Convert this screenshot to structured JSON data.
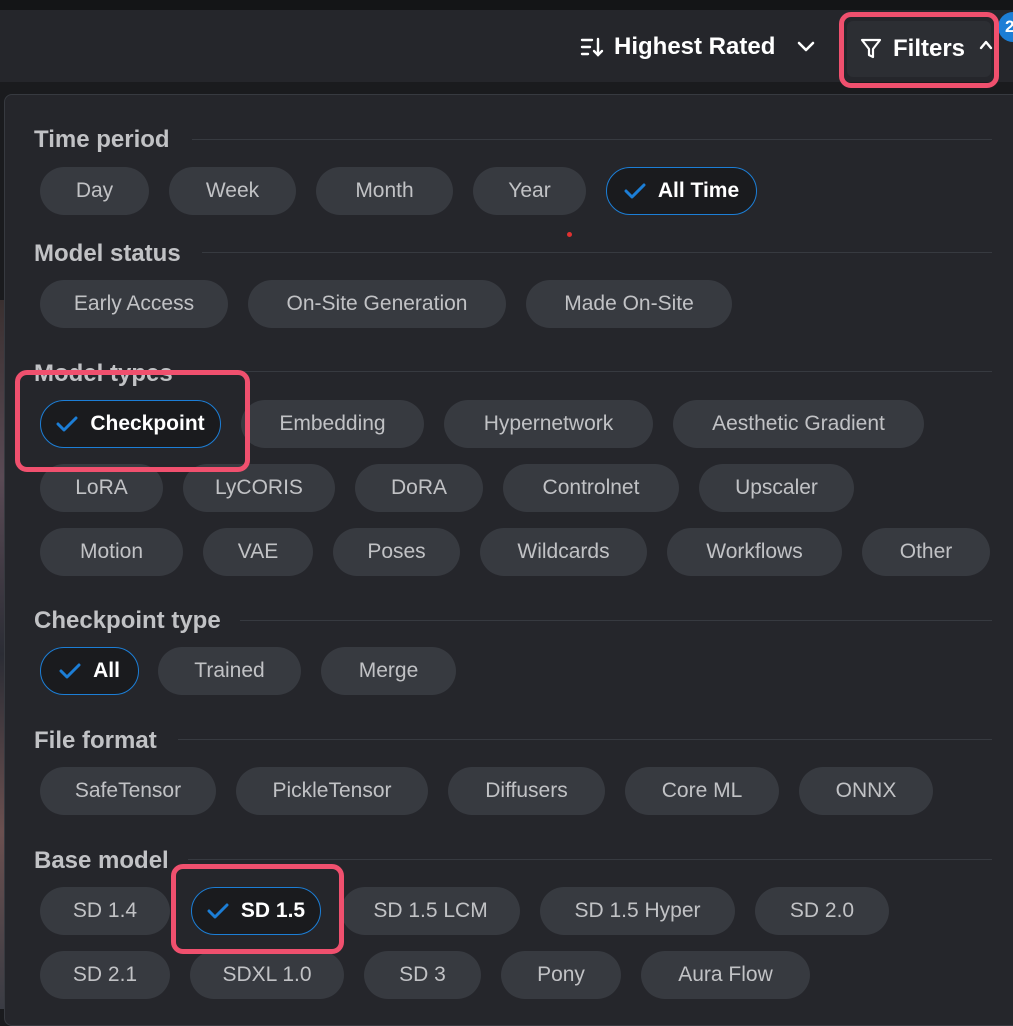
{
  "header": {
    "sort_label": "Highest Rated",
    "sort_icon": "sort-descending-icon",
    "filters_label": "Filters",
    "filters_icon": "funnel-icon",
    "filter_count": "2"
  },
  "colors": {
    "accent": "#1c7ed6",
    "highlight": "#f0506e",
    "chip_bg": "#373a40",
    "panel_bg": "#25262b"
  },
  "sections": {
    "time_period": {
      "title": "Time period",
      "options": [
        "Day",
        "Week",
        "Month",
        "Year",
        "All Time"
      ],
      "selected": "All Time"
    },
    "model_status": {
      "title": "Model status",
      "options": [
        "Early Access",
        "On-Site Generation",
        "Made On-Site"
      ]
    },
    "model_types": {
      "title": "Model types",
      "options": [
        "Checkpoint",
        "Embedding",
        "Hypernetwork",
        "Aesthetic Gradient",
        "LoRA",
        "LyCORIS",
        "DoRA",
        "Controlnet",
        "Upscaler",
        "Motion",
        "VAE",
        "Poses",
        "Wildcards",
        "Workflows",
        "Other"
      ],
      "selected": "Checkpoint"
    },
    "checkpoint_type": {
      "title": "Checkpoint type",
      "options": [
        "All",
        "Trained",
        "Merge"
      ],
      "selected": "All"
    },
    "file_format": {
      "title": "File format",
      "options": [
        "SafeTensor",
        "PickleTensor",
        "Diffusers",
        "Core ML",
        "ONNX"
      ]
    },
    "base_model": {
      "title": "Base model",
      "options": [
        "SD 1.4",
        "SD 1.5",
        "SD 1.5 LCM",
        "SD 1.5 Hyper",
        "SD 2.0",
        "SD 2.1",
        "SDXL 1.0",
        "SD 3",
        "Pony",
        "Aura Flow"
      ],
      "selected": "SD 1.5"
    }
  }
}
